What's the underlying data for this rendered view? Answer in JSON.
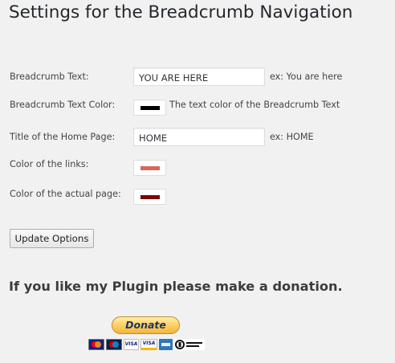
{
  "page": {
    "title": "Settings for the Breadcrumb Navigation"
  },
  "form": {
    "breadcrumb_text": {
      "label": "Breadcrumb Text:",
      "value": "YOU ARE HERE",
      "hint": "ex: You are here"
    },
    "breadcrumb_text_color": {
      "label": "Breadcrumb Text Color:",
      "color": "#000000",
      "hint": "The text color of the Breadcrumb Text"
    },
    "home_title": {
      "label": "Title of the Home Page:",
      "value": "HOME",
      "hint": "ex: HOME"
    },
    "links_color": {
      "label": "Color of the links:",
      "color": "#d9665a"
    },
    "actual_page_color": {
      "label": "Color of the actual page:",
      "color": "#7a0a0a"
    },
    "update_button_label": "Update Options"
  },
  "donation": {
    "heading": "If you like my Plugin please make a donation.",
    "button_label": "Donate",
    "cards": [
      {
        "name": "mastercard-icon"
      },
      {
        "name": "maestro-icon"
      },
      {
        "name": "visa-icon",
        "text": "VISA"
      },
      {
        "name": "visa-electron-icon",
        "text": "VISA"
      },
      {
        "name": "american-express-icon"
      },
      {
        "name": "direct-debit-icon"
      }
    ]
  }
}
